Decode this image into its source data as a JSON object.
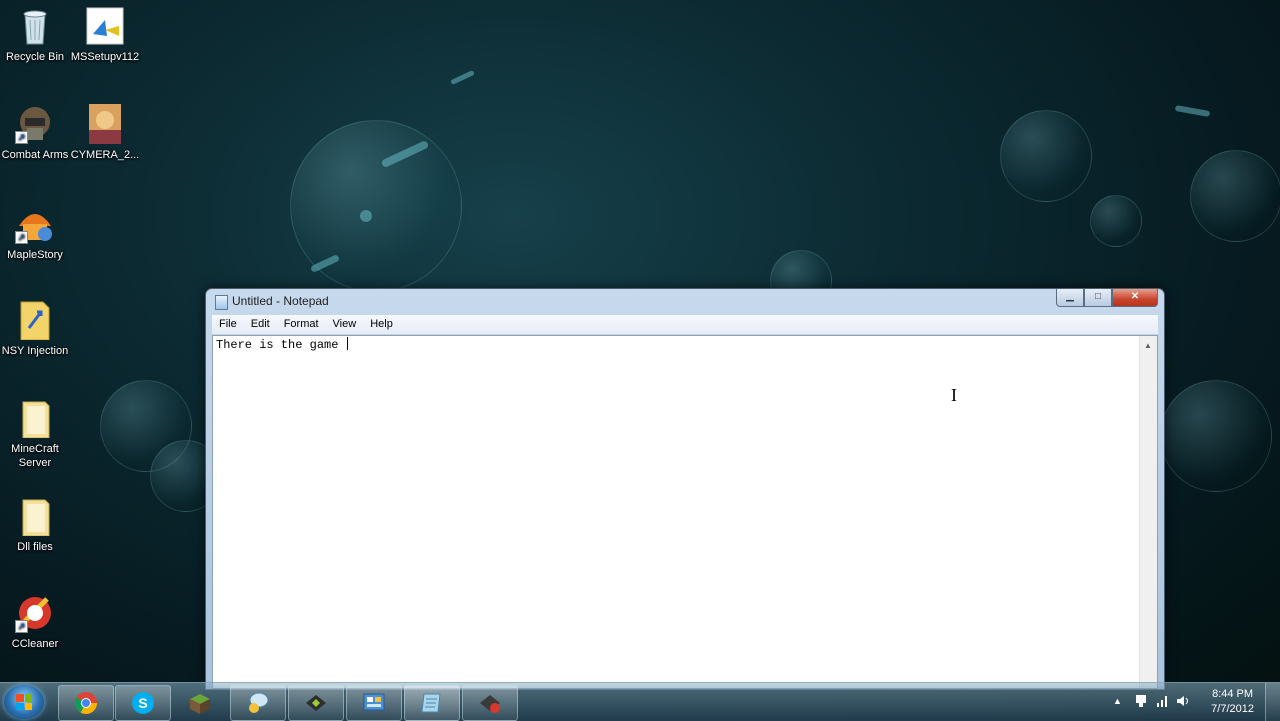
{
  "desktop": {
    "icons": [
      {
        "label": "Recycle Bin",
        "icon": "recycle-bin-icon"
      },
      {
        "label": "MSSetupv112",
        "icon": "setup-icon"
      },
      {
        "label": "Combat Arms",
        "icon": "combat-arms-icon"
      },
      {
        "label": "CYMERA_2...",
        "icon": "image-file-icon"
      },
      {
        "label": "MapleStory",
        "icon": "maplestory-icon"
      },
      {
        "label": "NSY Injection",
        "icon": "injector-icon"
      },
      {
        "label": "MineCraft Server",
        "icon": "folder-icon"
      },
      {
        "label": "Dll files",
        "icon": "folder-icon"
      },
      {
        "label": "CCleaner",
        "icon": "ccleaner-icon"
      }
    ]
  },
  "notepad": {
    "title": "Untitled - Notepad",
    "menu": [
      "File",
      "Edit",
      "Format",
      "View",
      "Help"
    ],
    "content": "There is the game ",
    "buttons": {
      "minimize": "▁",
      "maximize": "□",
      "close": "✕"
    }
  },
  "taskbar": {
    "apps": [
      {
        "name": "chrome",
        "icon": "chrome-icon"
      },
      {
        "name": "skype",
        "icon": "skype-icon"
      },
      {
        "name": "minecraft",
        "icon": "minecraft-icon"
      },
      {
        "name": "chat",
        "icon": "chat-icon"
      },
      {
        "name": "game-launcher",
        "icon": "game-launcher-icon"
      },
      {
        "name": "control-panel",
        "icon": "control-panel-icon"
      },
      {
        "name": "notepad",
        "icon": "notepad-icon"
      },
      {
        "name": "injector",
        "icon": "injector-icon"
      }
    ],
    "tray": {
      "time": "8:44 PM",
      "date": "7/7/2012"
    }
  }
}
